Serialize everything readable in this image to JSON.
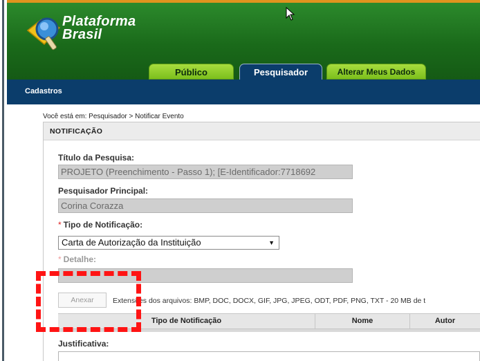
{
  "brand": {
    "logo_text_line1": "Plataforma",
    "logo_text_line2": "Brasil"
  },
  "tabs": [
    {
      "label": "Público"
    },
    {
      "label": "Pesquisador"
    },
    {
      "label": "Alterar Meus Dados"
    }
  ],
  "navbar": {
    "item": "Cadastros"
  },
  "breadcrumb": "Você está em: Pesquisador > Notificar Evento",
  "panel": {
    "title": "NOTIFICAÇÃO",
    "titulo_label": "Título da Pesquisa:",
    "titulo_value": "PROJETO (Preenchimento - Passo 1); [E-Identificador:7718692",
    "pesquisador_label": "Pesquisador Principal:",
    "pesquisador_value": "Corina Corazza",
    "required_mark": "*",
    "tipo_label": "Tipo de Notificação:",
    "tipo_selected": "Carta de Autorização da Instituição",
    "detalhe_label": "Detalhe:",
    "detalhe_value": "",
    "attach_button": "Anexar",
    "extensions_text": "Extensões dos arquivos: BMP, DOC, DOCX, GIF, JPG, JPEG, ODT, PDF, PNG, TXT - 20 MB de t",
    "table_headers": [
      "Tipo de Notificação",
      "Nome",
      "Autor"
    ],
    "justificativa_label": "Justificativa:"
  },
  "colors": {
    "header_green": "#1f6a1f",
    "nav_blue": "#0b3d6b",
    "tab_green": "#8ccc2a",
    "annotation_red": "#ff1414"
  }
}
